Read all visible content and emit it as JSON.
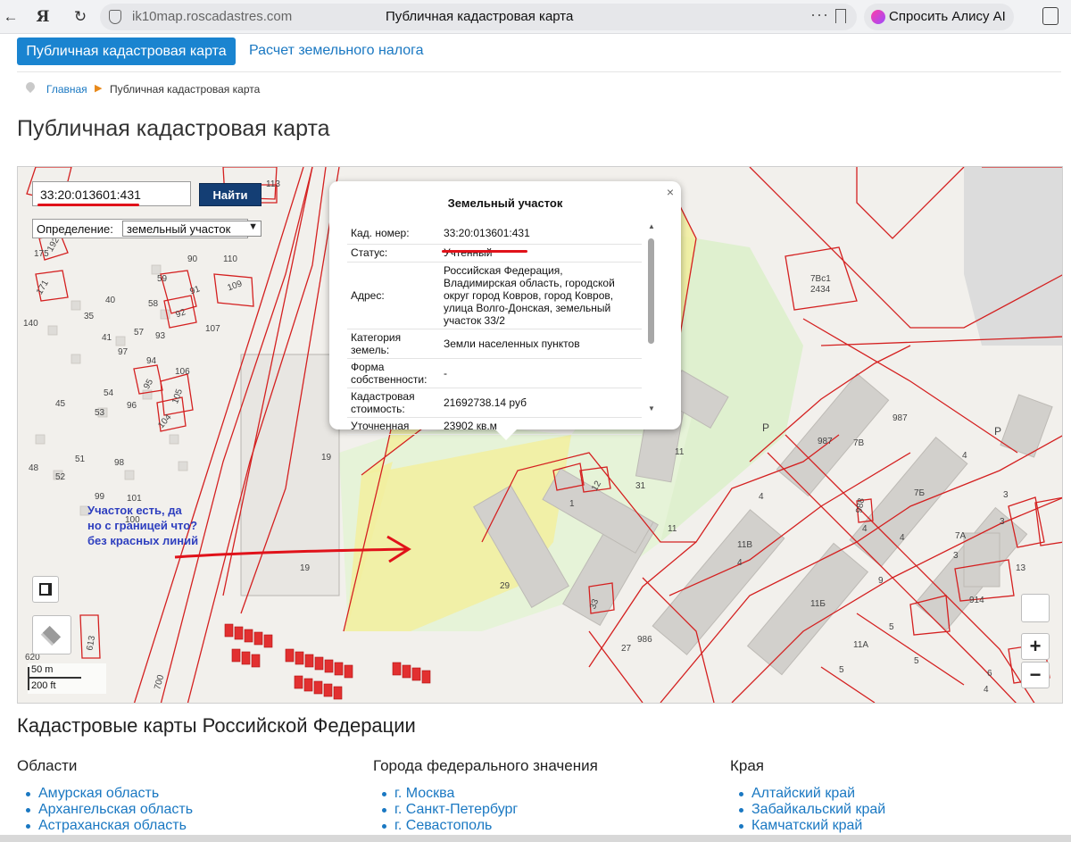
{
  "browser": {
    "domain": "ik10map.roscadastres.com",
    "page_title": "Публичная кадастровая карта",
    "alice_label": "Спросить Алису AI",
    "more": "···"
  },
  "nav": {
    "tab_map": "Публичная кадастровая карта",
    "tab_tax": "Расчет земельного налога"
  },
  "breadcrumb": {
    "home": "Главная",
    "current": "Публичная кадастровая карта"
  },
  "page_title": "Публичная кадастровая карта",
  "map": {
    "search_value": "33:20:013601:431",
    "find_button": "Найти",
    "definition_label": "Определение:",
    "definition_value": "земельный участок",
    "scale_m": "50 m",
    "scale_ft": "200 ft",
    "zoom_in": "+",
    "zoom_out": "−",
    "annotation": [
      "Участок есть, да",
      "но  с границей что?",
      "без красных линий"
    ],
    "labels": [
      "192",
      "171",
      "175",
      "140",
      "113",
      "90",
      "110",
      "91",
      "109",
      "92",
      "59",
      "58",
      "93",
      "40",
      "35",
      "41",
      "57",
      "107",
      "94",
      "95",
      "106",
      "105",
      "104",
      "54",
      "45",
      "96",
      "53",
      "51",
      "98",
      "52",
      "48",
      "99",
      "101",
      "100",
      "97",
      "19",
      "19",
      "613",
      "620",
      "700",
      "13",
      "1",
      "12",
      "31",
      "11",
      "11",
      "29",
      "33",
      "27",
      "986",
      "2434",
      "7Вс1",
      "987",
      "987",
      "7В",
      "4",
      "4",
      "7Б",
      "988",
      "4",
      "4",
      "3",
      "7А",
      "3",
      "13",
      "914",
      "11В",
      "4",
      "11Б",
      "5",
      "11А",
      "5",
      "5",
      "9",
      "4",
      "6",
      "3",
      "Р",
      "Р"
    ]
  },
  "popup": {
    "title": "Земельный участок",
    "close": "×",
    "rows": [
      {
        "k": "Кад. номер:",
        "v": "33:20:013601:431"
      },
      {
        "k": "Статус:",
        "v": "Учтенный"
      },
      {
        "k": "Адрес:",
        "v": "Российская Федерация, Владимирская область, городской округ город Ковров, город Ковров, улица Волго-Донская, земельный участок 33/2"
      },
      {
        "k": "Категория земель:",
        "v": "Земли населенных пунктов"
      },
      {
        "k": "Форма собственности:",
        "v": "-"
      },
      {
        "k": "Кадастровая стоимость:",
        "v": "21692738.14 руб"
      },
      {
        "k": "Уточненная площадь:",
        "v": "23902 кв.м"
      }
    ]
  },
  "regions": {
    "heading": "Кадастровые карты Российской Федерации",
    "columns": [
      {
        "title": "Области",
        "items": [
          "Амурская область",
          "Архангельская область",
          "Астраханская область"
        ]
      },
      {
        "title": "Города федерального значения",
        "items": [
          "г. Москва",
          "г. Санкт-Петербург",
          "г. Севастополь"
        ]
      },
      {
        "title": "Края",
        "items": [
          "Алтайский край",
          "Забайкальский край",
          "Камчатский край"
        ]
      }
    ]
  },
  "colors": {
    "accent": "#1a84d0",
    "parcel_line": "#d42020",
    "find_button": "#143e74",
    "annotation": "#2e3fbf"
  }
}
